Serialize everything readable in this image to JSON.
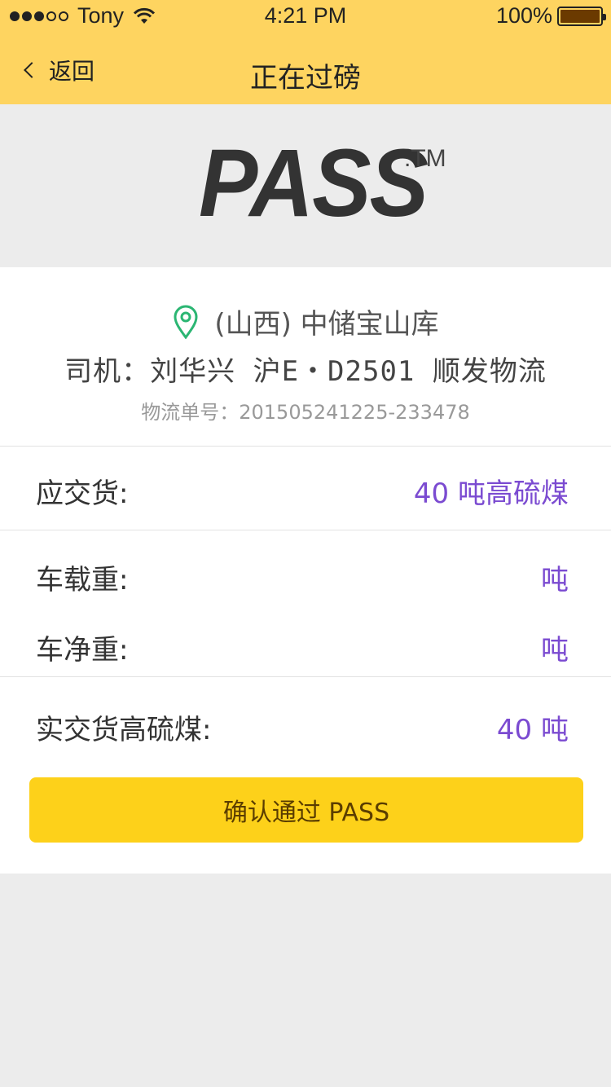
{
  "status_bar": {
    "carrier": "Tony",
    "time": "4:21 PM",
    "battery": "100%",
    "signal_bars_filled": 3,
    "signal_bars_total": 5
  },
  "nav": {
    "back_label": "返回",
    "title": "正在过磅"
  },
  "logo": {
    "text": "PASS",
    "tm": ".TM"
  },
  "info": {
    "location": "(山西) 中储宝山库",
    "driver_line": "司机：刘华兴 沪E・D2501 顺发物流",
    "order_label": "物流单号：",
    "order_number": "201505241225-233478"
  },
  "rows": {
    "due": {
      "label": "应交货:",
      "value": "40 吨高硫煤"
    },
    "gross": {
      "label": "车载重:",
      "value": "吨"
    },
    "net": {
      "label": "车净重:",
      "value": "吨"
    },
    "actual": {
      "label": "实交货高硫煤:",
      "value": "40 吨"
    }
  },
  "confirm_button": "确认通过 PASS",
  "colors": {
    "header_bg": "#fed460",
    "accent_value": "#7b4bd1",
    "button_bg": "#fdd11a",
    "pin_green": "#2bb673"
  }
}
